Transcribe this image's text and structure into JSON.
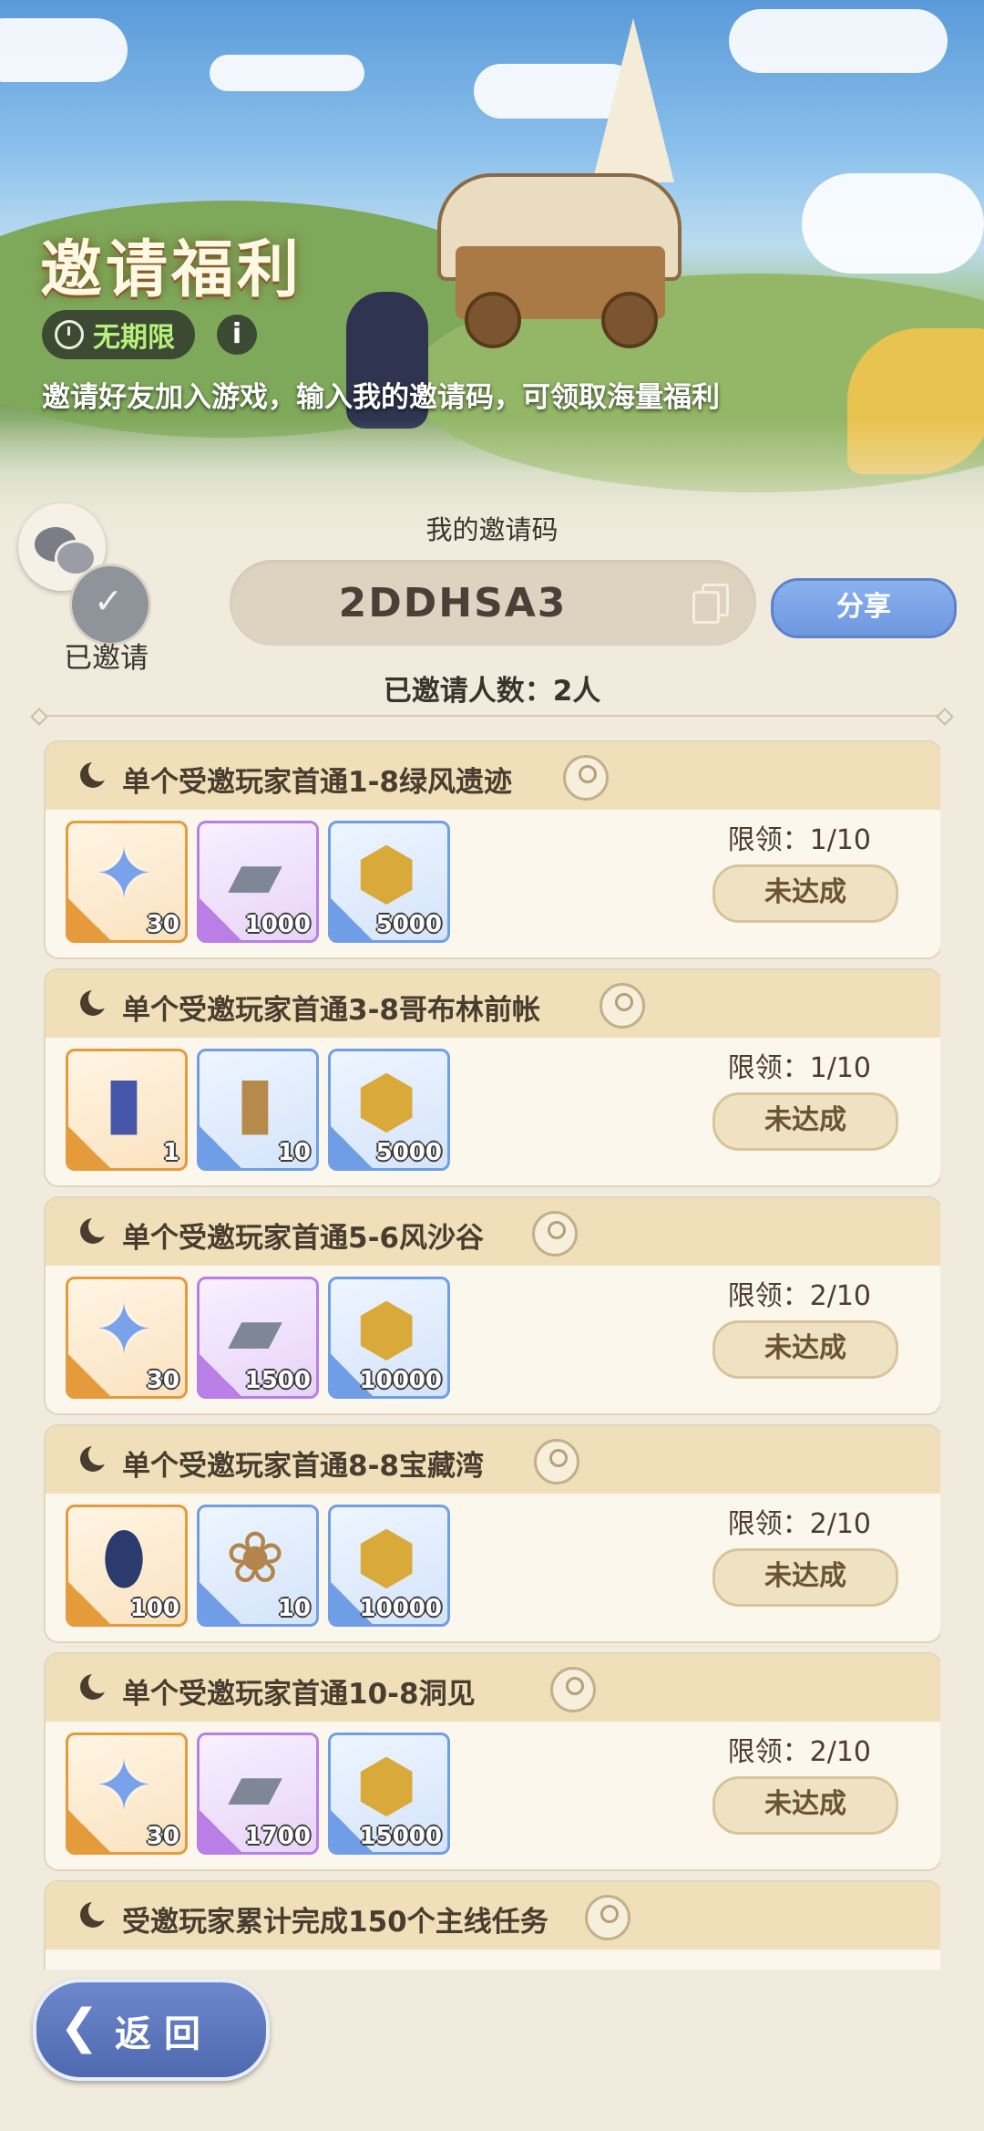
{
  "banner": {
    "title": "邀请福利",
    "duration_badge": "无期限",
    "info_icon": "i",
    "description": "邀请好友加入游戏，输入我的邀请码，可领取海量福利"
  },
  "invite": {
    "invited_label": "已邀请",
    "code_title": "我的邀请码",
    "code": "2DDHSA3",
    "share_label": "分享",
    "invited_count_text": "已邀请人数：2人"
  },
  "tasks": [
    {
      "title": "单个受邀玩家首通1-8绿风遗迹",
      "limit": "限领：1/10",
      "status": "未达成",
      "rewards": [
        {
          "icon": "star-crystal-icon",
          "glyph": "✦",
          "qty": "30",
          "rarity": "orange"
        },
        {
          "icon": "silver-ingot-icon",
          "glyph": "▰",
          "qty": "1000",
          "rarity": "purple"
        },
        {
          "icon": "gold-coin-icon",
          "glyph": "⬢",
          "qty": "5000",
          "rarity": "blue"
        }
      ]
    },
    {
      "title": "单个受邀玩家首通3-8哥布林前帐",
      "limit": "限领：1/10",
      "status": "未达成",
      "rewards": [
        {
          "icon": "eye-card-icon",
          "glyph": "▮",
          "qty": "1",
          "rarity": "orange"
        },
        {
          "icon": "star-scroll-icon",
          "glyph": "▮",
          "qty": "10",
          "rarity": "blue"
        },
        {
          "icon": "gold-coin-icon",
          "glyph": "⬢",
          "qty": "5000",
          "rarity": "blue"
        }
      ]
    },
    {
      "title": "单个受邀玩家首通5-6风沙谷",
      "limit": "限领：2/10",
      "status": "未达成",
      "rewards": [
        {
          "icon": "star-crystal-icon",
          "glyph": "✦",
          "qty": "30",
          "rarity": "orange"
        },
        {
          "icon": "silver-ingot-icon",
          "glyph": "▰",
          "qty": "1500",
          "rarity": "purple"
        },
        {
          "icon": "gold-coin-icon",
          "glyph": "⬢",
          "qty": "10000",
          "rarity": "blue"
        }
      ]
    },
    {
      "title": "单个受邀玩家首通8-8宝藏湾",
      "limit": "限领：2/10",
      "status": "未达成",
      "rewards": [
        {
          "icon": "rune-egg-icon",
          "glyph": "⬮",
          "qty": "100",
          "rarity": "orange"
        },
        {
          "icon": "paw-bag-icon",
          "glyph": "❀",
          "qty": "10",
          "rarity": "blue"
        },
        {
          "icon": "gold-coin-icon",
          "glyph": "⬢",
          "qty": "10000",
          "rarity": "blue"
        }
      ]
    },
    {
      "title": "单个受邀玩家首通10-8洞见",
      "limit": "限领：2/10",
      "status": "未达成",
      "rewards": [
        {
          "icon": "star-crystal-icon",
          "glyph": "✦",
          "qty": "30",
          "rarity": "orange"
        },
        {
          "icon": "silver-ingot-icon",
          "glyph": "▰",
          "qty": "1700",
          "rarity": "purple"
        },
        {
          "icon": "gold-coin-icon",
          "glyph": "⬢",
          "qty": "15000",
          "rarity": "blue"
        }
      ]
    },
    {
      "title": "受邀玩家累计完成150个主线任务",
      "limit": "",
      "status": "",
      "rewards": []
    }
  ],
  "back": {
    "label": "返回"
  },
  "colors": {
    "background": "#f1ebdd",
    "header_bar": "#efe0b9",
    "share_button": "#7fa6ea",
    "back_button": "#5a74bb"
  }
}
